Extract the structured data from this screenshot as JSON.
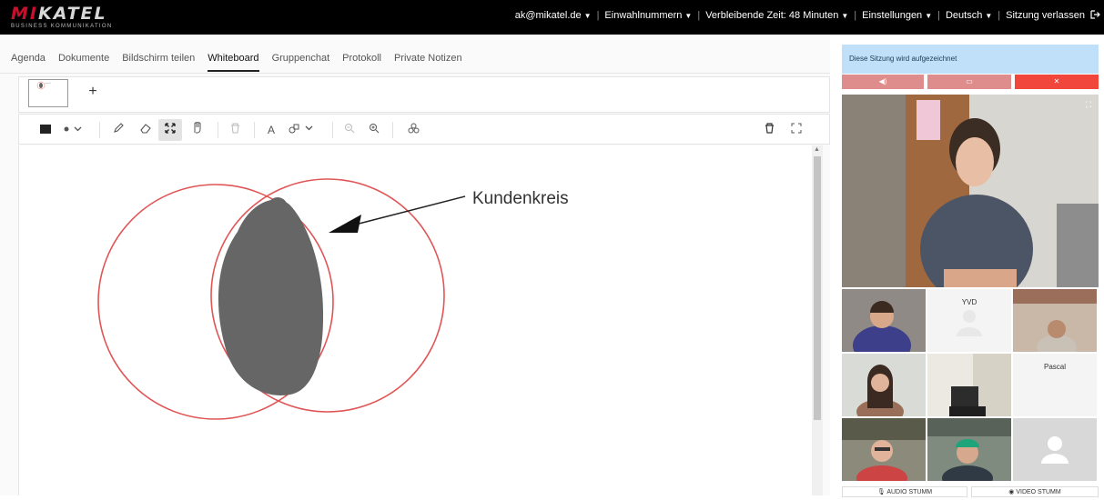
{
  "header": {
    "logo_text_red": "MI",
    "logo_text_rest": "KATEL",
    "logo_sub": "BUSINESS KOMMUNIKATION",
    "user": "ak@mikatel.de",
    "dial_in": "Einwahlnummern",
    "remaining_time": "Verbleibende Zeit: 48 Minuten",
    "settings": "Einstellungen",
    "language": "Deutsch",
    "leave": "Sitzung verlassen"
  },
  "tabs": [
    "Agenda",
    "Dokumente",
    "Bildschirm teilen",
    "Whiteboard",
    "Gruppenchat",
    "Protokoll",
    "Private Notizen"
  ],
  "active_tab": "Whiteboard",
  "pages": {
    "add_label": "+"
  },
  "toolbar": {
    "icons": [
      "rectangle-icon",
      "dot-size-icon",
      "pencil-icon",
      "eraser-icon",
      "move-icon",
      "hand-icon",
      "delete-icon",
      "text-icon",
      "shape-icon",
      "zoom-out-icon",
      "zoom-in-icon",
      "layers-icon",
      "trash-icon",
      "fullscreen-icon"
    ],
    "selected": "move-icon",
    "text_tool_label": "A"
  },
  "whiteboard": {
    "annotation_text": "Kundenkreis",
    "circle_color": "#e05555",
    "blob_color": "#666666"
  },
  "sidebar": {
    "recording_notice": "Diese Sitzung wird aufgezeichnet",
    "controls": [
      {
        "name": "speaker",
        "color": "#df8c8c"
      },
      {
        "name": "camera",
        "color": "#df8c8c"
      },
      {
        "name": "close",
        "color": "#f0463c"
      }
    ],
    "participants": [
      "YVD",
      "Pascal"
    ],
    "audio_mute": "AUDIO STUMM",
    "video_mute": "VIDEO STUMM"
  }
}
